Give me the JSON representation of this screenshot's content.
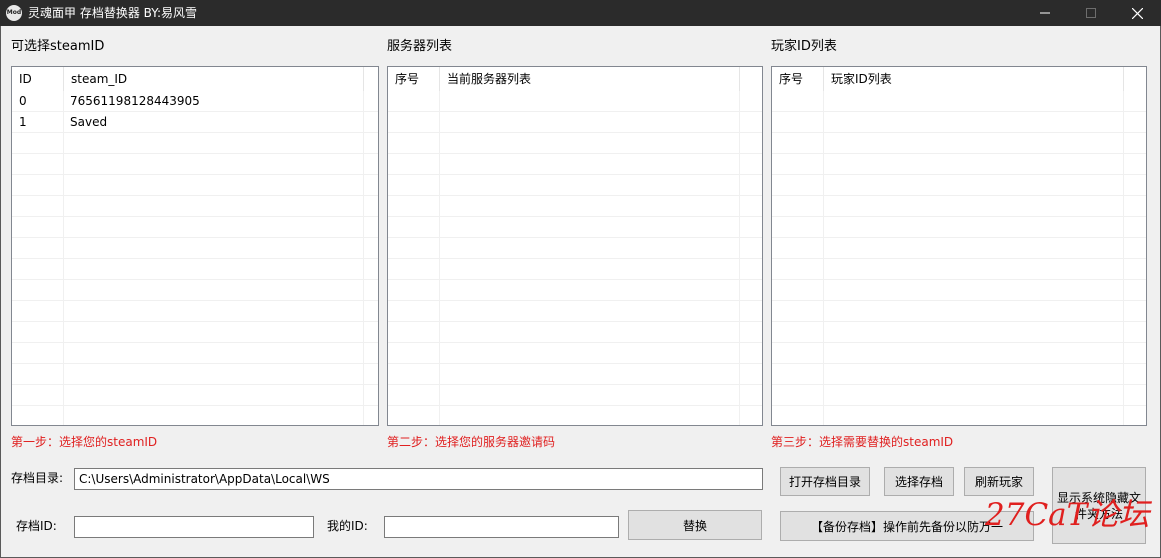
{
  "window": {
    "title": "灵魂面甲 存档替换器   BY:易风雪",
    "icon_text": "Mod",
    "controls": [
      "minimize-icon",
      "maximize-icon",
      "close-icon"
    ]
  },
  "steam_panel": {
    "label": "可选择steamID",
    "columns": [
      "ID",
      "steam_ID"
    ],
    "rows": [
      {
        "id": "0",
        "steam_id": "76561198128443905"
      },
      {
        "id": "1",
        "steam_id": "Saved"
      }
    ],
    "hint": "第一步：选择您的steamID"
  },
  "server_panel": {
    "label": "服务器列表",
    "columns": [
      "序号",
      "当前服务器列表"
    ],
    "rows": [],
    "hint": "第二步：选择您的服务器邀请码"
  },
  "player_panel": {
    "label": "玩家ID列表",
    "columns": [
      "序号",
      "玩家ID列表"
    ],
    "rows": [],
    "hint": "第三步：选择需要替换的steamID"
  },
  "form": {
    "save_dir_label": "存档目录:",
    "save_dir_value": "C:\\Users\\Administrator\\AppData\\Local\\WS",
    "save_id_label": "存档ID:",
    "save_id_value": "",
    "my_id_label": "我的ID:",
    "my_id_value": ""
  },
  "buttons": {
    "open_dir": "打开存档目录",
    "select_save": "选择存档",
    "refresh_players": "刷新玩家",
    "show_hidden": "显示系统隐藏文件夹方法",
    "replace": "替换",
    "backup": "【备份存档】操作前先备份以防万一"
  },
  "watermark": "27CaT论坛"
}
